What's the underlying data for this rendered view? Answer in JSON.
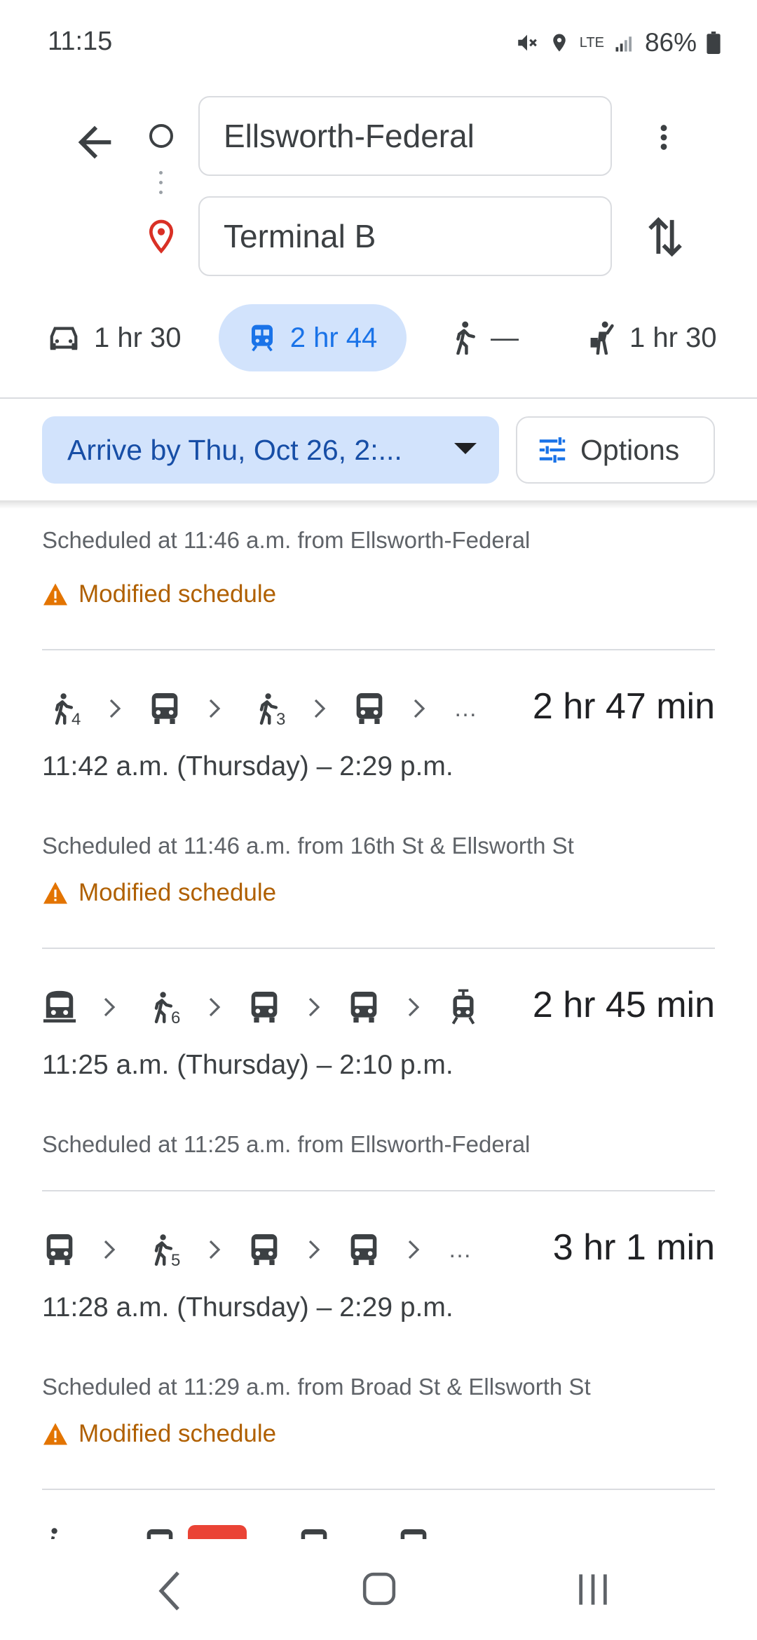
{
  "status_bar": {
    "time": "11:15",
    "network": "LTE",
    "battery": "86%"
  },
  "search": {
    "origin": "Ellsworth-Federal",
    "destination": "Terminal B"
  },
  "modes": [
    {
      "icon": "car-icon",
      "label": "1 hr 30"
    },
    {
      "icon": "transit-icon",
      "label": "2 hr 44",
      "selected": true
    },
    {
      "icon": "walk-icon",
      "label": "—"
    },
    {
      "icon": "rideshare-icon",
      "label": "1 hr 30"
    }
  ],
  "filters": {
    "arrive_by": "Arrive by Thu, Oct 26, 2:...",
    "options": "Options"
  },
  "partial_top": {
    "scheduled": "Scheduled at 11:46 a.m. from Ellsworth-Federal",
    "notice": "Modified schedule"
  },
  "routes": [
    {
      "steps": [
        "walk:4",
        "bus",
        "walk:3",
        "bus",
        "more"
      ],
      "duration": "2 hr 47 min",
      "times": "11:42 a.m. (Thursday) – 2:29 p.m.",
      "scheduled": "Scheduled at 11:46 a.m. from 16th St & Ellsworth St",
      "notice": "Modified schedule"
    },
    {
      "steps": [
        "subway",
        "walk:6",
        "bus",
        "bus",
        "tram"
      ],
      "duration": "2 hr 45 min",
      "times": "11:25 a.m. (Thursday) – 2:10 p.m.",
      "scheduled": "Scheduled at 11:25 a.m. from Ellsworth-Federal"
    },
    {
      "steps": [
        "bus",
        "walk:5",
        "bus",
        "bus",
        "more"
      ],
      "duration": "3 hr 1 min",
      "times": "11:28 a.m. (Thursday) – 2:29 p.m.",
      "scheduled": "Scheduled at 11:29 a.m. from Broad St & Ellsworth St",
      "notice": "Modified schedule"
    }
  ],
  "colors": {
    "accent": "#1a73e8",
    "selected_bg": "#d2e3fc",
    "warning": "#b06000"
  }
}
